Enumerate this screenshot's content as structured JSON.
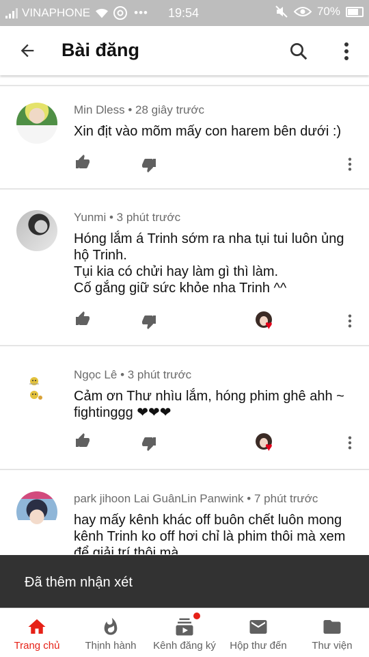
{
  "status_bar": {
    "carrier": "VINAPHONE",
    "time": "19:54",
    "battery": "70%",
    "icons": [
      "signal-icon",
      "wifi-icon",
      "chrome-icon",
      "more-notifications-icon",
      "mute-icon",
      "eye-icon",
      "battery-icon"
    ]
  },
  "app_bar": {
    "title": "Bài đăng",
    "icons": [
      "back-arrow-icon",
      "search-icon",
      "more-vert-icon"
    ]
  },
  "comments": [
    {
      "author": "Min Dless",
      "time": "28 giây trước",
      "text": "Xin địt vào mõm mấy con harem bên dưới :)",
      "creator_heart": false
    },
    {
      "author": "Yunmi",
      "time": "3 phút trước",
      "text": "Hóng lắm á Trinh sớm ra nha tụi tui luôn ủng hộ Trinh.\nTụi kia có chửi hay làm gì thì làm.\nCố gắng giữ sức khỏe nha Trinh ^^",
      "creator_heart": true
    },
    {
      "author": "Ngọc Lê",
      "time": "3 phút trước",
      "text": "Cảm ơn Thư nhìu lắm, hóng phim ghê ahh ~ fightinggg ❤❤❤",
      "creator_heart": true
    },
    {
      "author": "park jihoon Lai GuânLin Panwink",
      "time": "7 phút trước",
      "text": "hay mấy kênh khác off buôn chết luôn mong kênh Trinh ko off hơi chỉ là phim thôi mà xem để giải trí thôi mà",
      "creator_heart": false
    }
  ],
  "meta_separator": "•",
  "snackbar": {
    "message": "Đã thêm nhận xét"
  },
  "bottom_nav": [
    {
      "label": "Trang chủ",
      "icon": "home-icon",
      "active": true
    },
    {
      "label": "Thịnh hành",
      "icon": "flame-icon",
      "active": false
    },
    {
      "label": "Kênh đăng ký",
      "icon": "subscriptions-icon",
      "active": false,
      "badge": true
    },
    {
      "label": "Hộp thư đến",
      "icon": "mail-icon",
      "active": false
    },
    {
      "label": "Thư viện",
      "icon": "folder-icon",
      "active": false
    }
  ],
  "colors": {
    "accent": "#e62117",
    "snackbar": "#323232",
    "status_bar": "#bdbdbd",
    "meta_text": "#6b6b6b",
    "creator_heart": "#e2001a"
  }
}
